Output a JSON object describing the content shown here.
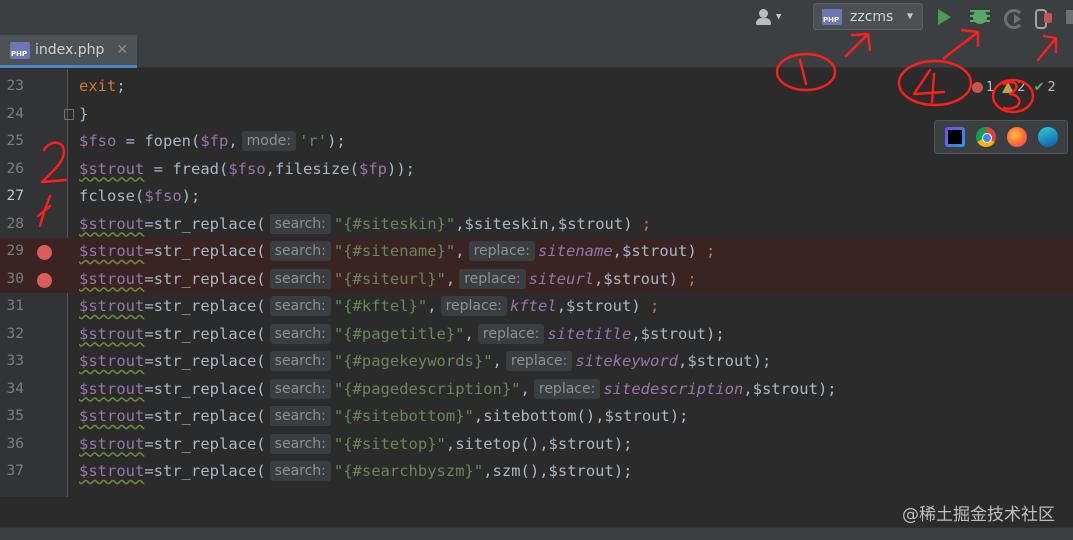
{
  "toolbar": {
    "user_icon": "user-icon",
    "run_config": {
      "name": "zzcms",
      "icon": "php-icon"
    },
    "actions": [
      {
        "name": "run",
        "icon": "play-icon",
        "color": "#499c54"
      },
      {
        "name": "debug",
        "icon": "bug-icon",
        "color": "#59a869"
      },
      {
        "name": "run-with-coverage",
        "icon": "coverage-icon"
      },
      {
        "name": "attach-debugger",
        "icon": "attach-icon"
      }
    ]
  },
  "tabs": [
    {
      "label": "index.php",
      "icon": "php-file-icon",
      "active": true
    }
  ],
  "inspections": {
    "errors": "1",
    "warnings": "2",
    "weak": "2"
  },
  "browsers": [
    "phpstorm-icon",
    "chrome-icon",
    "firefox-icon",
    "edge-icon"
  ],
  "editor": {
    "lines": [
      {
        "n": "23",
        "tokens": [
          [
            "kw",
            "exit"
          ],
          [
            "p",
            ";"
          ]
        ]
      },
      {
        "n": "24",
        "tokens": [
          [
            "p",
            "}"
          ]
        ]
      },
      {
        "n": "25",
        "tokens": [
          [
            "var",
            "$fso"
          ],
          [
            "p",
            " = fopen("
          ],
          [
            "var",
            "$fp"
          ],
          [
            "p",
            ","
          ],
          [
            "hint",
            "mode:"
          ],
          [
            "str",
            "'r'"
          ],
          [
            "p",
            ");"
          ]
        ]
      },
      {
        "n": "26",
        "tokens": [
          [
            "varw",
            "$strout"
          ],
          [
            "p",
            " = fread("
          ],
          [
            "var",
            "$fso"
          ],
          [
            "p",
            ",filesize("
          ],
          [
            "var",
            "$fp"
          ],
          [
            "p",
            "));"
          ]
        ]
      },
      {
        "n": "27",
        "tokens": [
          [
            "p",
            "fclose("
          ],
          [
            "var",
            "$fso"
          ],
          [
            "p",
            ");"
          ]
        ]
      },
      {
        "n": "28",
        "tokens": [
          [
            "varw",
            "$strout"
          ],
          [
            "p",
            "=str_replace("
          ],
          [
            "hint",
            "search:"
          ],
          [
            "str",
            "\"{#siteskin}\""
          ],
          [
            "p",
            ",$siteskin,$strout) "
          ],
          [
            "kw",
            ";"
          ]
        ]
      },
      {
        "n": "29",
        "tokens": [
          [
            "varw",
            "$strout"
          ],
          [
            "p",
            "=str_replace("
          ],
          [
            "hint",
            "search:"
          ],
          [
            "str",
            "\"{#sitename}\""
          ],
          [
            "p",
            ","
          ],
          [
            "hint",
            "replace:"
          ],
          [
            "it",
            "sitename"
          ],
          [
            "p",
            ",$strout) "
          ],
          [
            "kw",
            ";"
          ]
        ]
      },
      {
        "n": "30",
        "tokens": [
          [
            "varw",
            "$strout"
          ],
          [
            "p",
            "=str_replace("
          ],
          [
            "hint",
            "search:"
          ],
          [
            "str",
            "\"{#siteurl}\""
          ],
          [
            "p",
            ","
          ],
          [
            "hint",
            "replace:"
          ],
          [
            "it",
            "siteurl"
          ],
          [
            "p",
            ",$strout) "
          ],
          [
            "kw",
            ";"
          ]
        ]
      },
      {
        "n": "31",
        "tokens": [
          [
            "varw",
            "$strout"
          ],
          [
            "p",
            "=str_replace("
          ],
          [
            "hint",
            "search:"
          ],
          [
            "str",
            "\"{#kftel}\""
          ],
          [
            "p",
            ","
          ],
          [
            "hint",
            "replace:"
          ],
          [
            "it",
            "kftel"
          ],
          [
            "p",
            ",$strout) "
          ],
          [
            "kw",
            ";"
          ]
        ]
      },
      {
        "n": "32",
        "tokens": [
          [
            "varw",
            "$strout"
          ],
          [
            "p",
            "=str_replace("
          ],
          [
            "hint",
            "search:"
          ],
          [
            "str",
            "\"{#pagetitle}\""
          ],
          [
            "p",
            ","
          ],
          [
            "hint",
            "replace:"
          ],
          [
            "it",
            "sitetitle"
          ],
          [
            "p",
            ",$strout);"
          ]
        ]
      },
      {
        "n": "33",
        "tokens": [
          [
            "varw",
            "$strout"
          ],
          [
            "p",
            "=str_replace("
          ],
          [
            "hint",
            "search:"
          ],
          [
            "str",
            "\"{#pagekeywords}\""
          ],
          [
            "p",
            ","
          ],
          [
            "hint",
            "replace:"
          ],
          [
            "it",
            "sitekeyword"
          ],
          [
            "p",
            ",$strout);"
          ]
        ]
      },
      {
        "n": "34",
        "tokens": [
          [
            "varw",
            "$strout"
          ],
          [
            "p",
            "=str_replace("
          ],
          [
            "hint",
            "search:"
          ],
          [
            "str",
            "\"{#pagedescription}\""
          ],
          [
            "p",
            ","
          ],
          [
            "hint",
            "replace:"
          ],
          [
            "it",
            "sitedescription"
          ],
          [
            "p",
            ",$strout);"
          ]
        ]
      },
      {
        "n": "35",
        "tokens": [
          [
            "varw",
            "$strout"
          ],
          [
            "p",
            "=str_replace("
          ],
          [
            "hint",
            "search:"
          ],
          [
            "str",
            "\"{#sitebottom}\""
          ],
          [
            "p",
            ",sitebottom(),$strout);"
          ]
        ]
      },
      {
        "n": "36",
        "tokens": [
          [
            "varw",
            "$strout"
          ],
          [
            "p",
            "=str_replace("
          ],
          [
            "hint",
            "search:"
          ],
          [
            "str",
            "\"{#sitetop}\""
          ],
          [
            "p",
            ",sitetop(),$strout);"
          ]
        ]
      },
      {
        "n": "37",
        "tokens": [
          [
            "varw",
            "$strout"
          ],
          [
            "p",
            "=str_replace("
          ],
          [
            "hint",
            "search:"
          ],
          [
            "str",
            "\"{#searchbyszm}\""
          ],
          [
            "p",
            ",szm(),$strout);"
          ]
        ]
      }
    ],
    "breakpoints": [
      "29",
      "30"
    ],
    "current_line": "27"
  },
  "annotations": {
    "labels": [
      "1",
      "2",
      "1",
      "4",
      "3"
    ],
    "color": "#ff1e1e"
  },
  "watermark": "@稀土掘金技术社区"
}
